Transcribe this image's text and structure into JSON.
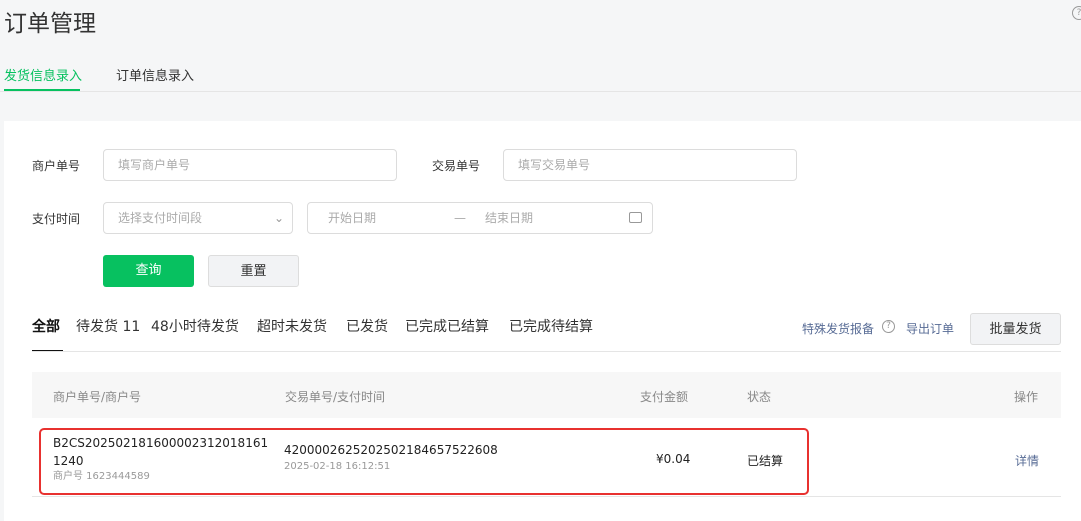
{
  "page_title": "订单管理",
  "tabs": [
    {
      "label": "发货信息录入",
      "active": true
    },
    {
      "label": "订单信息录入",
      "active": false
    }
  ],
  "form": {
    "merchant_no_label": "商户单号",
    "merchant_no_placeholder": "填写商户单号",
    "trade_no_label": "交易单号",
    "trade_no_placeholder": "填写交易单号",
    "pay_time_label": "支付时间",
    "pay_time_select_placeholder": "选择支付时间段",
    "start_date_placeholder": "开始日期",
    "date_separator": "—",
    "end_date_placeholder": "结束日期",
    "search_label": "查询",
    "reset_label": "重置"
  },
  "filters": [
    {
      "label": "全部",
      "active": true
    },
    {
      "label": "待发货 11"
    },
    {
      "label": "48小时待发货"
    },
    {
      "label": "超时未发货"
    },
    {
      "label": "已发货"
    },
    {
      "label": "已完成已结算"
    },
    {
      "label": "已完成待结算"
    }
  ],
  "actions": {
    "special_report": "特殊发货报备",
    "export": "导出订单",
    "batch_ship": "批量发货"
  },
  "table": {
    "headers": [
      "商户单号/商户号",
      "交易单号/支付时间",
      "支付金额",
      "状态",
      "操作"
    ],
    "rows": [
      {
        "merchant_order_line1": "B2CS202502181600002312018161",
        "merchant_order_line2": "1240",
        "merchant_id": "商户号 1623444589",
        "trade_no": "4200002625202502184657522608",
        "pay_time": "2025-02-18 16:12:51",
        "amount": "¥0.04",
        "status": "已结算",
        "action": "详情"
      }
    ]
  },
  "colors": {
    "accent": "#07c160",
    "link": "#576b95",
    "highlight": "#e8312f"
  }
}
